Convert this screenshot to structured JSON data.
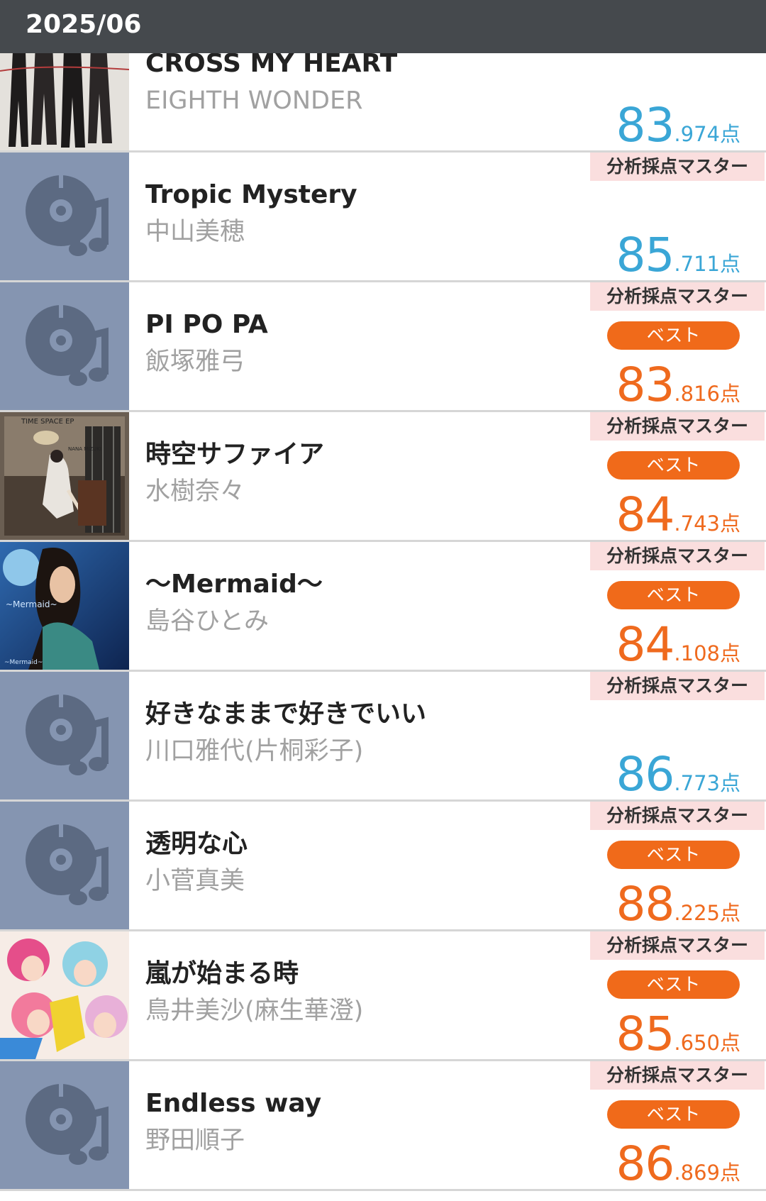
{
  "header": {
    "month": "2025/06"
  },
  "rows": [
    {
      "title": "CROSS MY HEART",
      "artist": "EIGHTH WONDER",
      "thumb": "album-art-eighth-wonder",
      "score_int": "83",
      "score_dec": ".974点",
      "best": "",
      "score_color": "#3aa6d6"
    },
    {
      "mode": "分析採点マスター",
      "title": "Tropic Mystery",
      "artist": "中山美穂",
      "thumb": "music-disc-icon",
      "score_int": "85",
      "score_dec": ".711点",
      "best": "",
      "score_color": "#3aa6d6"
    },
    {
      "mode": "分析採点マスター",
      "title": "PI PO PA",
      "artist": "飯塚雅弓",
      "thumb": "music-disc-icon",
      "best": "ベスト",
      "score_int": "83",
      "score_dec": ".816点",
      "score_color": "#ef6a1e"
    },
    {
      "mode": "分析採点マスター",
      "title": "時空サファイア",
      "artist": "水樹奈々",
      "thumb": "album-art-time-space-ep",
      "thumb_text": "TIME SPACE EP",
      "thumb_text2": "NANA MIZUKI",
      "best": "ベスト",
      "score_int": "84",
      "score_dec": ".743点",
      "score_color": "#ef6a1e"
    },
    {
      "mode": "分析採点マスター",
      "title": "〜Mermaid〜",
      "artist": "島谷ひとみ",
      "thumb": "album-art-mermaid",
      "thumb_text": "~Mermaid~",
      "best": "ベスト",
      "score_int": "84",
      "score_dec": ".108点",
      "score_color": "#ef6a1e"
    },
    {
      "mode": "分析採点マスター",
      "title": "好きなままで好きでいい",
      "artist": "川口雅代(片桐彩子)",
      "thumb": "music-disc-icon",
      "best": "",
      "score_int": "86",
      "score_dec": ".773点",
      "score_color": "#3aa6d6"
    },
    {
      "mode": "分析採点マスター",
      "title": "透明な心",
      "artist": "小菅真美",
      "thumb": "music-disc-icon",
      "best": "ベスト",
      "score_int": "88",
      "score_dec": ".225点",
      "score_color": "#ef6a1e"
    },
    {
      "mode": "分析採点マスター",
      "title": "嵐が始まる時",
      "artist": "鳥井美沙(麻生華澄)",
      "thumb": "album-art-anime",
      "best": "ベスト",
      "score_int": "85",
      "score_dec": ".650点",
      "score_color": "#ef6a1e"
    },
    {
      "mode": "分析採点マスター",
      "title": "Endless way",
      "artist": "野田順子",
      "thumb": "music-disc-icon",
      "best": "ベスト",
      "score_int": "86",
      "score_dec": ".869点",
      "score_color": "#ef6a1e"
    }
  ],
  "colors": {
    "header": "#45494d",
    "placeholder_bg": "#8595b1",
    "tag_bg": "#fadede",
    "best_bg": "#f06a1a",
    "score_blue": "#3aa6d6",
    "score_orange": "#ef6a1e"
  }
}
